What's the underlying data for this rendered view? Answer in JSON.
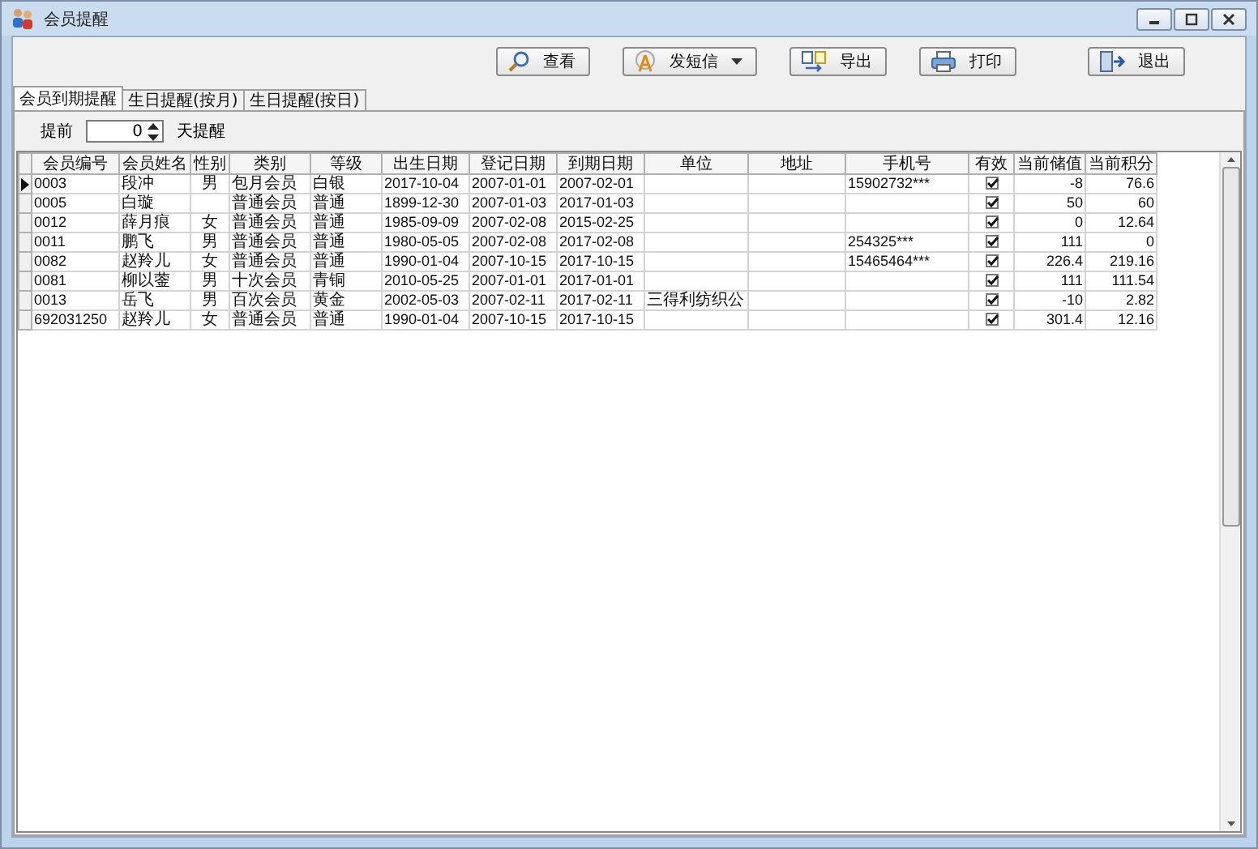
{
  "window": {
    "title": "会员提醒"
  },
  "toolbar": [
    {
      "label": "查看",
      "dropdown": false
    },
    {
      "label": "发短信",
      "dropdown": true
    },
    {
      "label": "导出",
      "dropdown": false
    },
    {
      "label": "打印",
      "dropdown": false
    },
    {
      "label": "退出",
      "dropdown": false
    }
  ],
  "tabs": [
    {
      "label": "会员到期提醒",
      "selected": true
    },
    {
      "label": "生日提醒(按月)",
      "selected": false
    },
    {
      "label": "生日提醒(按日)",
      "selected": false
    }
  ],
  "filter": {
    "prefix": "提前",
    "value": "0",
    "suffix": "天提醒"
  },
  "table": {
    "columns": [
      "会员编号",
      "会员姓名",
      "性别",
      "类别",
      "等级",
      "出生日期",
      "登记日期",
      "到期日期",
      "单位",
      "地址",
      "手机号",
      "有效",
      "当前储值",
      "当前积分"
    ],
    "rows": [
      {
        "selected": true,
        "cells": [
          "0003",
          "段冲",
          "男",
          "包月会员",
          "白银",
          "2017-10-04",
          "2007-01-01",
          "2007-02-01",
          "",
          "",
          "15902732***"
        ],
        "valid": true,
        "balance": "-8",
        "points": "76.6"
      },
      {
        "selected": false,
        "cells": [
          "0005",
          "白璇",
          "",
          "普通会员",
          "普通",
          "1899-12-30",
          "2007-01-03",
          "2017-01-03",
          "",
          "",
          ""
        ],
        "valid": true,
        "balance": "50",
        "points": "60"
      },
      {
        "selected": false,
        "cells": [
          "0012",
          "薛月痕",
          "女",
          "普通会员",
          "普通",
          "1985-09-09",
          "2007-02-08",
          "2015-02-25",
          "",
          "",
          ""
        ],
        "valid": true,
        "balance": "0",
        "points": "12.64"
      },
      {
        "selected": false,
        "cells": [
          "0011",
          "鹏飞",
          "男",
          "普通会员",
          "普通",
          "1980-05-05",
          "2007-02-08",
          "2017-02-08",
          "",
          "",
          "254325***"
        ],
        "valid": true,
        "balance": "111",
        "points": "0"
      },
      {
        "selected": false,
        "cells": [
          "0082",
          "赵羚儿",
          "女",
          "普通会员",
          "普通",
          "1990-01-04",
          "2007-10-15",
          "2017-10-15",
          "",
          "",
          "15465464***"
        ],
        "valid": true,
        "balance": "226.4",
        "points": "219.16"
      },
      {
        "selected": false,
        "cells": [
          "0081",
          "柳以蓥",
          "男",
          "十次会员",
          "青铜",
          "2010-05-25",
          "2007-01-01",
          "2017-01-01",
          "",
          "",
          ""
        ],
        "valid": true,
        "balance": "111",
        "points": "111.54"
      },
      {
        "selected": false,
        "cells": [
          "0013",
          "岳飞",
          "男",
          "百次会员",
          "黄金",
          "2002-05-03",
          "2007-02-11",
          "2017-02-11",
          "三得利纺织公",
          "",
          ""
        ],
        "valid": true,
        "balance": "-10",
        "points": "2.82"
      },
      {
        "selected": false,
        "cells": [
          "692031250",
          "赵羚儿",
          "女",
          "普通会员",
          "普通",
          "1990-01-04",
          "2007-10-15",
          "2017-10-15",
          "",
          "",
          ""
        ],
        "valid": true,
        "balance": "301.4",
        "points": "12.16"
      }
    ]
  }
}
